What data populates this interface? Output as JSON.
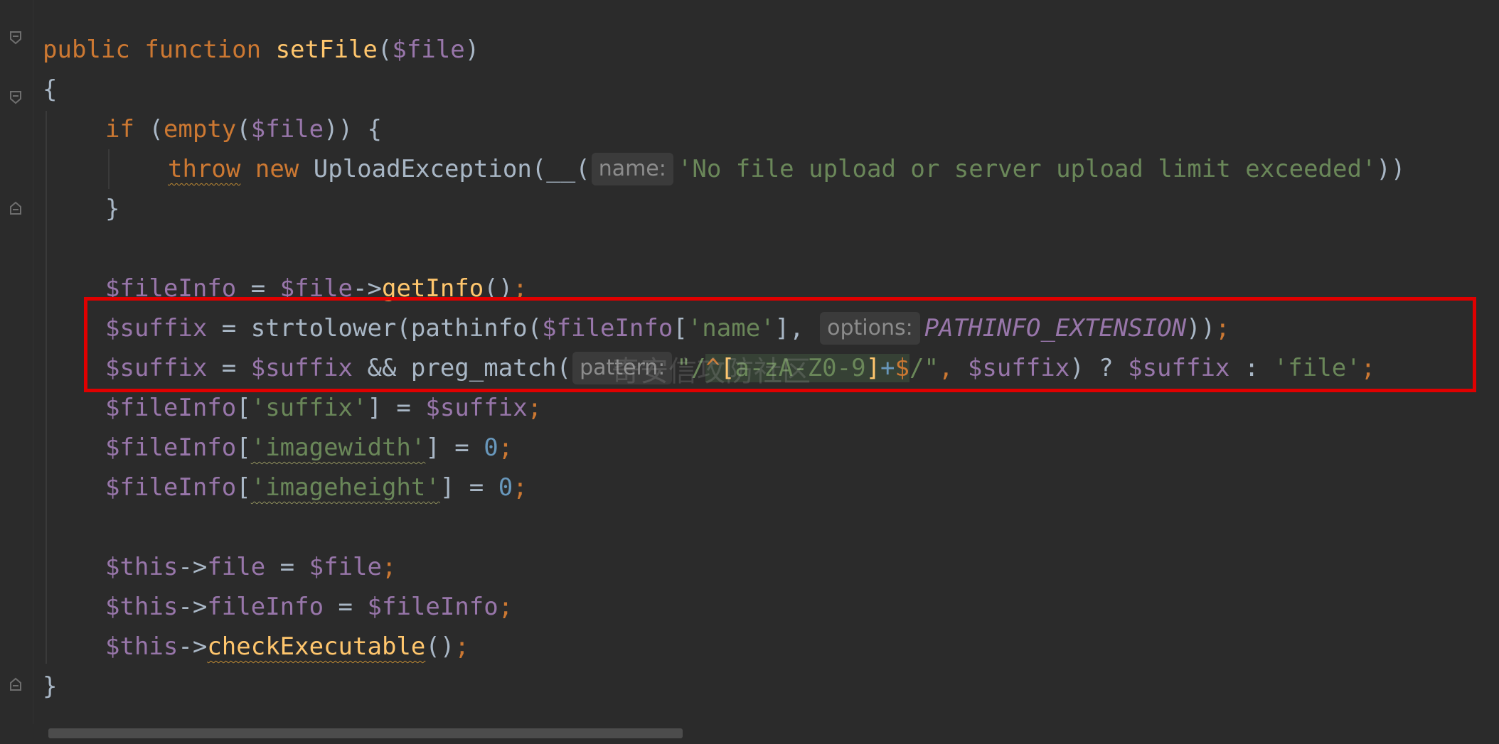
{
  "code": {
    "l1": {
      "kw1": "public",
      "kw2": "function",
      "name": "setFile",
      "open": "(",
      "param": "$file",
      "close": ")"
    },
    "l2": {
      "brace": "{"
    },
    "l3": {
      "kw": "if",
      "open": " (",
      "fn": "empty",
      "open2": "(",
      "var": "$file",
      "rest": ")) {"
    },
    "l4": {
      "kw1": "throw",
      "kw2": "new",
      "cls": "UploadException",
      "call": "(__(",
      "hint": "name:",
      "str": "'No file upload or server upload limit exceeded'",
      "rest": "))"
    },
    "l5": {
      "brace": "}"
    },
    "l6": {
      "var1": "$fileInfo",
      "eq": " = ",
      "var2": "$file",
      "arrow": "->",
      "fn": "getInfo",
      "rest": "()",
      "semi": ";"
    },
    "l7": {
      "var1": "$suffix",
      "eq": " = strtolower(pathinfo(",
      "var2": "$fileInfo",
      "b1": "[",
      "str": "'name'",
      "b2": "],",
      "hint": "options:",
      "const": "PATHINFO_EXTENSION",
      "rest": "))",
      "semi": ";"
    },
    "l8": {
      "var1": "$suffix",
      "eq": " = ",
      "var2": "$suffix",
      "and": " && preg_match(",
      "hint": "pattern:",
      "q1": "\"/",
      "re1": "^",
      "re2": "[",
      "re3": "a-zA-Z0-9",
      "re4": "]",
      "re5": "+",
      "re6": "$",
      "q2": "/\"",
      "comma": ", ",
      "var3": "$suffix",
      "tern": ") ? ",
      "var4": "$suffix",
      "colon": " : ",
      "str": "'file'",
      "semi": ";"
    },
    "l9": {
      "var": "$fileInfo",
      "b1": "[",
      "str": "'suffix'",
      "b2": "] = ",
      "var2": "$suffix",
      "semi": ";"
    },
    "l10": {
      "var": "$fileInfo",
      "b1": "[",
      "str": "'imagewidth'",
      "b2": "] = ",
      "num": "0",
      "semi": ";"
    },
    "l11": {
      "var": "$fileInfo",
      "b1": "[",
      "str": "'imageheight'",
      "b2": "] = ",
      "num": "0",
      "semi": ";"
    },
    "l12": {
      "var": "$this",
      "arrow": "->",
      "prop": "file",
      "eq": " = ",
      "var2": "$file",
      "semi": ";"
    },
    "l13": {
      "var": "$this",
      "arrow": "->",
      "prop": "fileInfo",
      "eq": " = ",
      "var2": "$fileInfo",
      "semi": ";"
    },
    "l14": {
      "var": "$this",
      "arrow": "->",
      "fn": "checkExecutable",
      "rest": "()",
      "semi": ";"
    },
    "l15": {
      "brace": "}"
    }
  },
  "watermark": "奇安信攻防社区",
  "colors": {
    "background": "#2b2b2b",
    "keyword": "#cc7832",
    "function": "#ffc66d",
    "variable": "#9876aa",
    "string": "#6a8759",
    "number": "#6897bb",
    "highlight_border": "#e00000"
  }
}
